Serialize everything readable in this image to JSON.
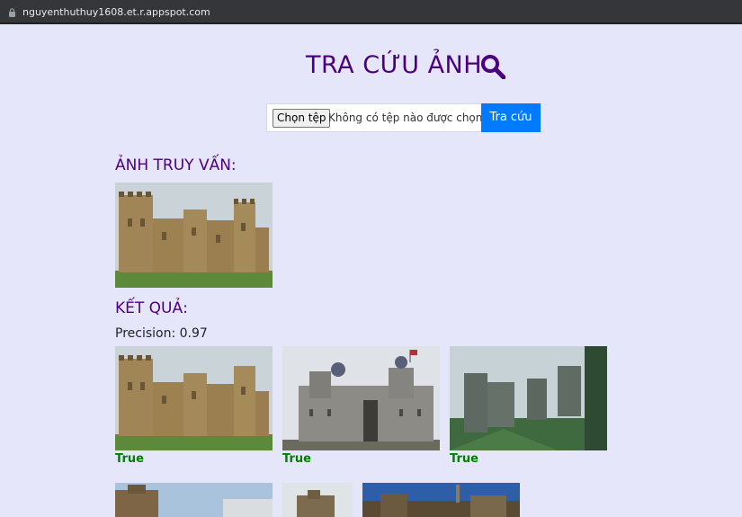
{
  "browser": {
    "url": "nguyenthuthuy1608.et.r.appspot.com"
  },
  "header": {
    "title": "TRA CỨU ẢNH"
  },
  "upload": {
    "choose_label": "Chọn tệp",
    "no_file_label": "Không có tệp nào được chọn",
    "submit_label": "Tra cứu"
  },
  "query": {
    "heading": "ẢNH TRUY VẤN:"
  },
  "results": {
    "heading": "KẾT QUẢ:",
    "precision_text": "Precision: 0.97",
    "items": [
      {
        "label": "True"
      },
      {
        "label": "True"
      },
      {
        "label": "True"
      }
    ]
  },
  "colors": {
    "accent": "#4b0082",
    "button": "#007bff",
    "true_label": "#008000",
    "background": "#e6e6fa"
  }
}
